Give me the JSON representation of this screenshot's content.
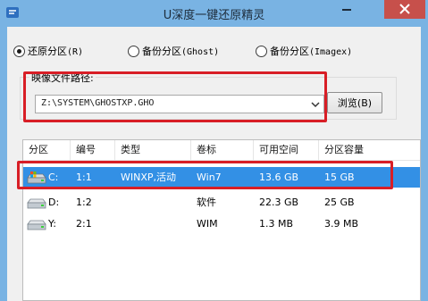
{
  "window": {
    "title": "U深度一键还原精灵"
  },
  "radio_options": [
    {
      "label": "还原分区",
      "suffix": "(R)",
      "selected": true
    },
    {
      "label": "备份分区",
      "suffix": "(Ghost)",
      "selected": false
    },
    {
      "label": "备份分区",
      "suffix": "(Imagex)",
      "selected": false
    }
  ],
  "image_path": {
    "label": "映像文件路径:",
    "value": "Z:\\SYSTEM\\GHOSTXP.GHO",
    "browse_label": "浏览(B)"
  },
  "table": {
    "columns": [
      "分区",
      "编号",
      "类型",
      "卷标",
      "可用空间",
      "分区容量"
    ],
    "rows": [
      {
        "drive": "C:",
        "number": "1:1",
        "type": "WINXP,活动",
        "label": "Win7",
        "free": "13.6 GB",
        "capacity": "15 GB",
        "selected": true,
        "icon": "windows-drive-icon"
      },
      {
        "drive": "D:",
        "number": "1:2",
        "type": "",
        "label": "软件",
        "free": "22.3 GB",
        "capacity": "25 GB",
        "selected": false,
        "icon": "drive-icon"
      },
      {
        "drive": "Y:",
        "number": "2:1",
        "type": "",
        "label": "WIM",
        "free": "1.3 MB",
        "capacity": "3.9 MB",
        "selected": false,
        "icon": "drive-icon"
      }
    ]
  },
  "colors": {
    "titlebar": "#79b3e3",
    "close_button": "#c7504b",
    "selection": "#3390e5",
    "highlight_box": "#d81e26"
  }
}
